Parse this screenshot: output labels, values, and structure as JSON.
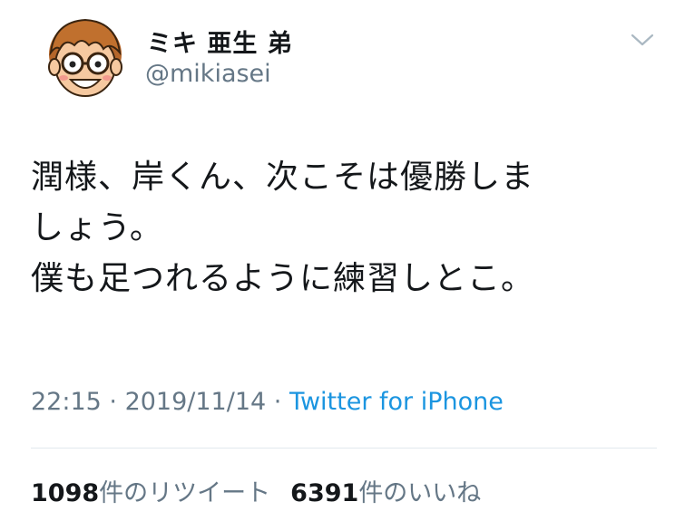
{
  "user": {
    "display_name": "ミキ 亜生 弟",
    "handle": "@mikiasei",
    "avatar_icon": "cartoon-avatar-icon"
  },
  "menu_icon": "chevron-down-icon",
  "tweet": {
    "lines": [
      "潤様、岸くん、次こそは優勝しま",
      "しょう。",
      "僕も足つれるように練習しとこ。"
    ]
  },
  "meta": {
    "time": "22:15",
    "separator1": " · ",
    "date": "2019/11/14",
    "separator2": " · ",
    "source": "Twitter for iPhone"
  },
  "stats": {
    "retweets_count": "1098",
    "retweets_label": "件のリツイート",
    "likes_count": "6391",
    "likes_label": "件のいいね"
  },
  "colors": {
    "text_primary": "#14171a",
    "text_secondary": "#657786",
    "link": "#1b95e0",
    "divider": "#e1e8ed"
  }
}
